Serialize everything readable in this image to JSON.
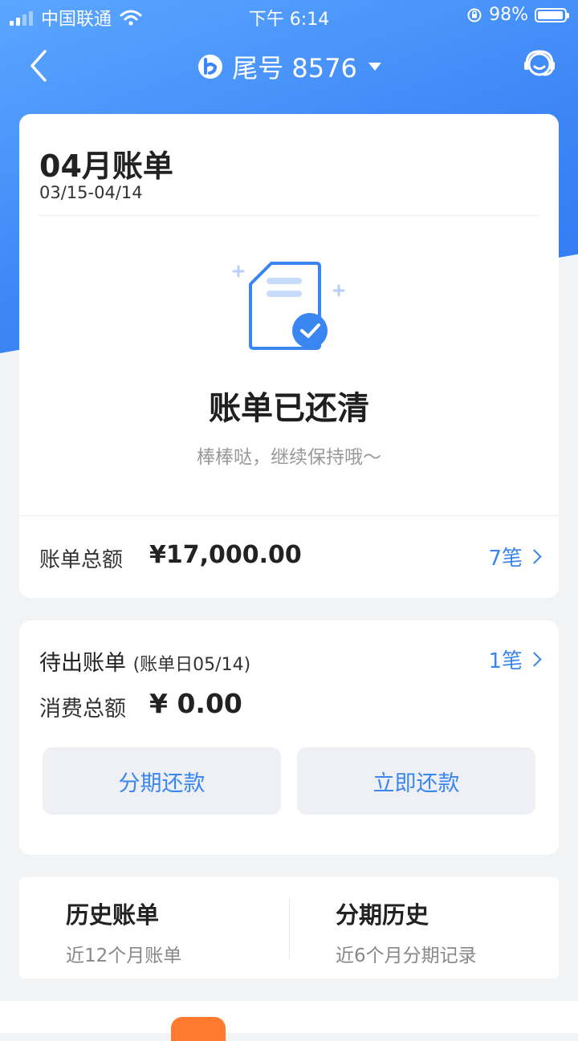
{
  "status_bar": {
    "carrier": "中国联通",
    "time": "下午 6:14",
    "battery": "98%"
  },
  "nav": {
    "title": "尾号 8576"
  },
  "bill": {
    "title": "04月账单",
    "range": "03/15-04/14",
    "status": "账单已还清",
    "message": "棒棒哒，继续保持哦～",
    "total_label": "账单总额",
    "total_amount": "¥17,000.00",
    "count": "7笔"
  },
  "pending": {
    "title": "待出账单",
    "sub": "(账单日05/14)",
    "count": "1笔",
    "consumption_label": "消费总额",
    "consumption_amount": "¥ 0.00",
    "installment_button": "分期还款",
    "repay_button": "立即还款"
  },
  "history": {
    "bills_title": "历史账单",
    "bills_sub": "近12个月账单",
    "installments_title": "分期历史",
    "installments_sub": "近6个月分期记录"
  },
  "colors": {
    "accent": "#3a86f0",
    "header": "#3d86f7"
  }
}
